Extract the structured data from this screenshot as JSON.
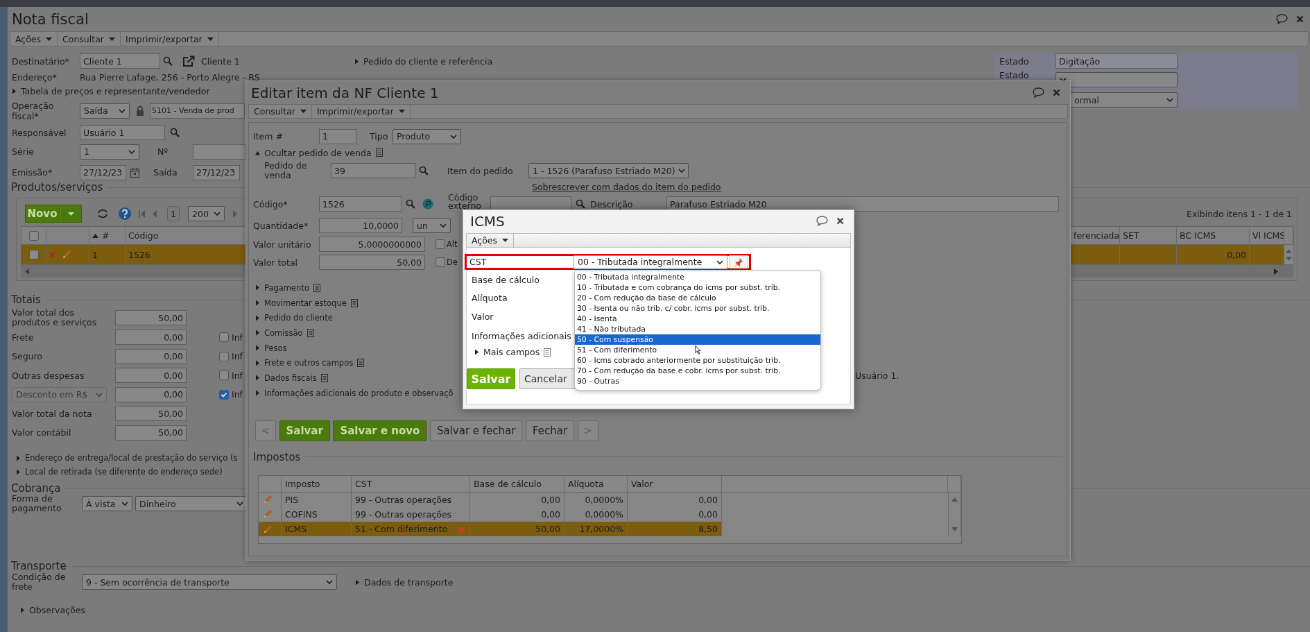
{
  "main_window": {
    "title": "Nota fiscal",
    "menu": [
      "Ações",
      "Consultar",
      "Imprimir/exportar"
    ],
    "recipient": {
      "label": "Destinatário*",
      "value": "Cliente 1",
      "link": "Cliente 1"
    },
    "order_reference": {
      "label": "Pedido do cliente e referência",
      "expanded": false
    },
    "address": {
      "label": "Endereço*",
      "value": "Rua Pierre Lafage, 256 - Porto Alegre - RS"
    },
    "price_table": {
      "label": "Tabela de preços e representante/vendedor",
      "expanded": false
    },
    "operation": {
      "label": "Operação fiscal*",
      "direction": "Saída",
      "cfop": "5101 - Venda de prod"
    },
    "responsible": {
      "label": "Responsável",
      "value": "Usuário 1"
    },
    "series": {
      "label": "Série",
      "value": "1",
      "number_label": "Nº"
    },
    "dates": {
      "issue_label": "Emissão*",
      "issue": "27/12/23",
      "exit_label": "Saída",
      "exit": "27/12/23"
    },
    "status_panel": [
      {
        "label": "Estado",
        "value": "Digitação",
        "kind": "text"
      },
      {
        "label": "Estado",
        "kind": "select"
      },
      {
        "value": "ormal",
        "kind": "select"
      }
    ],
    "products": {
      "title": "Produtos/serviços",
      "new_button": "Novo",
      "page": "1",
      "page_size": "200",
      "summary": "Exibindo itens 1 - 1 de 1",
      "all_checked": false,
      "columns_left": [
        "#",
        "Código"
      ],
      "columns_right": [
        "ferenciada",
        "SET",
        "BC ICMS",
        "Vl ICMS"
      ],
      "rows": [
        {
          "number": "1",
          "code": "1526",
          "bc_icms": "0,00",
          "selected": true,
          "checked": false
        }
      ]
    },
    "totals": {
      "title": "Totais",
      "rows": [
        {
          "label": "Valor total dos produtos e serviços",
          "value": "50,00",
          "kind": "field"
        },
        {
          "label": "Frete",
          "value": "0,00",
          "kind": "field",
          "check": {
            "label": "Inf",
            "checked": false
          }
        },
        {
          "label": "Seguro",
          "value": "0,00",
          "kind": "field",
          "check": {
            "label": "Inf",
            "checked": false
          }
        },
        {
          "label": "Outras despesas",
          "value": "0,00",
          "kind": "field",
          "check": {
            "label": "Inf",
            "checked": false
          }
        },
        {
          "label": "Desconto em R$",
          "value": "0,00",
          "kind": "select",
          "check": {
            "label": "Inf",
            "checked": true
          }
        },
        {
          "label": "Valor total da nota",
          "value": "50,00",
          "kind": "field"
        },
        {
          "label": "Valor contábil",
          "value": "50,00",
          "kind": "field"
        }
      ]
    },
    "links": [
      {
        "label": "Endereço de entrega/local de prestação do serviço (s",
        "expanded": false
      },
      {
        "label": "Local de retirada (se diferente do endereço sede)",
        "expanded": false
      }
    ],
    "billing": {
      "title": "Cobrança",
      "label": "Forma de pagamento",
      "term": "À vista",
      "method": "Dinheiro"
    },
    "transport": {
      "title": "Transporte",
      "label": "Condição de frete",
      "value": "9 - Sem ocorrência de transporte",
      "link": {
        "label": "Dados de transporte",
        "expanded": false
      }
    },
    "notes": {
      "label": "Observações",
      "expanded": false
    }
  },
  "edit_dialog": {
    "title": "Editar item da NF Cliente 1",
    "menu": [
      "Consultar",
      "Imprimir/exportar"
    ],
    "item": {
      "label": "Item #",
      "value": "1",
      "type_label": "Tipo",
      "type": "Produto"
    },
    "order_toggle": {
      "label": "Ocultar pedido de venda",
      "expanded": true
    },
    "order": {
      "label": "Pedido de venda",
      "value": "39",
      "item_label": "Item do pedido",
      "item": "1 - 1526 (Parafuso Estriado M20)",
      "overwrite_link": "Sobrescrever com dados do item do pedido"
    },
    "code": {
      "label": "Código*",
      "value": "1526",
      "external_label": "Código externo",
      "description_label": "Descrição",
      "description": "Parafuso Estriado M20"
    },
    "quantity": {
      "label": "Quantidade*",
      "value": "10,0000",
      "unit": "un"
    },
    "unit_price": {
      "label": "Valor unitário",
      "value": "5,0000000000",
      "check": {
        "label": "Alt",
        "checked": false
      }
    },
    "total": {
      "label": "Valor total",
      "value": "50,00",
      "check": {
        "label": "De",
        "checked": false
      }
    },
    "sections": [
      {
        "label": "Pagamento",
        "note": true,
        "expanded": false
      },
      {
        "label": "Movimentar estoque",
        "note": true,
        "expanded": false
      },
      {
        "label": "Pedido do cliente",
        "note": false,
        "expanded": false
      },
      {
        "label": "Comissão",
        "note": true,
        "expanded": false
      },
      {
        "label": "Pesos",
        "note": false,
        "expanded": false
      },
      {
        "label": "Frete e outros campos",
        "note": true,
        "expanded": false
      },
      {
        "label": "Dados fiscais",
        "note": true,
        "expanded": false
      },
      {
        "label": "Informações adicionais do produto e observaçõ",
        "note": false,
        "expanded": false
      }
    ],
    "buttons": [
      {
        "label": "<",
        "kind": "nav"
      },
      {
        "label": "Salvar",
        "kind": "primary"
      },
      {
        "label": "Salvar e novo",
        "kind": "primary"
      },
      {
        "label": "Salvar e fechar",
        "kind": "default"
      },
      {
        "label": "Fechar",
        "kind": "default"
      },
      {
        "label": ">",
        "kind": "nav"
      }
    ],
    "user_note": "Usuário 1.",
    "taxes": {
      "title": "Impostos",
      "columns": [
        "Imposto",
        "CST",
        "Base de cálculo",
        "Alíquota",
        "Valor"
      ],
      "rows": [
        {
          "tax": "PIS",
          "cst": "99 - Outras operações",
          "base": "0,00",
          "rate": "0,0000%",
          "value": "0,00",
          "selected": false,
          "pinned": false
        },
        {
          "tax": "COFINS",
          "cst": "99 - Outras operações",
          "base": "0,00",
          "rate": "0,0000%",
          "value": "0,00",
          "selected": false,
          "pinned": false
        },
        {
          "tax": "ICMS",
          "cst": "51 - Com diferimento",
          "base": "50,00",
          "rate": "17,0000%",
          "value": "8,50",
          "selected": true,
          "pinned": true
        }
      ]
    }
  },
  "icms_dialog": {
    "title": "ICMS",
    "menu": [
      "Ações"
    ],
    "cst": {
      "label": "CST",
      "value": "00 - Tributada integralmente",
      "highlighted": true
    },
    "fields": [
      "Base de cálculo",
      "Alíquota",
      "Valor",
      "Informações adicionais"
    ],
    "more": {
      "label": "Mais campos",
      "expanded": false
    },
    "buttons": [
      {
        "label": "Salvar",
        "kind": "primary"
      },
      {
        "label": "Cancelar",
        "kind": "default"
      }
    ],
    "options": [
      {
        "label": "00 - Tributada integralmente",
        "selected": false
      },
      {
        "label": "10 - Tributada e com cobrança do icms por subst. trib.",
        "selected": false
      },
      {
        "label": "20 - Com redução da base de cálculo",
        "selected": false
      },
      {
        "label": "30 - Isenta ou não trib. c/ cobr. icms por subst. trib.",
        "selected": false
      },
      {
        "label": "40 - Isenta",
        "selected": false
      },
      {
        "label": "41 - Não tributada",
        "selected": false
      },
      {
        "label": "50 - Com suspensão",
        "selected": true
      },
      {
        "label": "51 - Com diferimento",
        "selected": false
      },
      {
        "label": "60 - Icms cobrado anteriormente por substituição trib.",
        "selected": false
      },
      {
        "label": "70 - Com redução da base e cobr. icms por subst. trib.",
        "selected": false
      },
      {
        "label": "90 - Outras",
        "selected": false
      }
    ]
  }
}
